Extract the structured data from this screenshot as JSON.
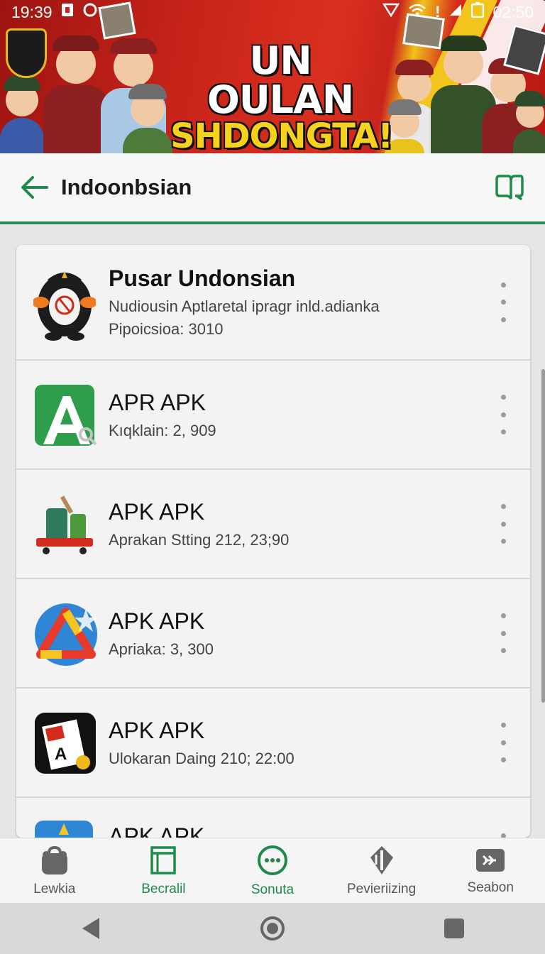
{
  "status_bar": {
    "time_left": "19:39",
    "indicator": "6 ⁑",
    "time_right": "02:50"
  },
  "banner": {
    "title_line1": "UN OULAN",
    "title_line2": "SHDONGTA!"
  },
  "toolbar": {
    "title": "Indoonbsian"
  },
  "apps": [
    {
      "name": "Pusar Undonsian",
      "subtitle": "Nudiousin Aptlaretal ipragr inld.adianka",
      "subtitle2": "Pipoicsioa: 3010"
    },
    {
      "name": "APR APK",
      "subtitle": "Kıqklain: 2, 909"
    },
    {
      "name": "APK APK",
      "subtitle": "Aprakan Stting 212, 23;90"
    },
    {
      "name": "APK APK",
      "subtitle": "Apriaka: 3, 300"
    },
    {
      "name": "APK APK",
      "subtitle": "Ulokaran Daing 210; 22:00"
    },
    {
      "name": "APK APK"
    }
  ],
  "bottom_nav": [
    {
      "label": "Lewkia",
      "icon": "bag-icon"
    },
    {
      "label": "Becralil",
      "icon": "calendar-icon",
      "active": true
    },
    {
      "label": "Sonuta",
      "icon": "chat-icon",
      "active": true
    },
    {
      "label": "Pevieriizing",
      "icon": "pen-icon"
    },
    {
      "label": "Seabon",
      "icon": "forward-icon"
    }
  ],
  "colors": {
    "accent": "#1f8a4c",
    "banner_red": "#c9241a",
    "banner_yellow": "#f6d21e"
  }
}
